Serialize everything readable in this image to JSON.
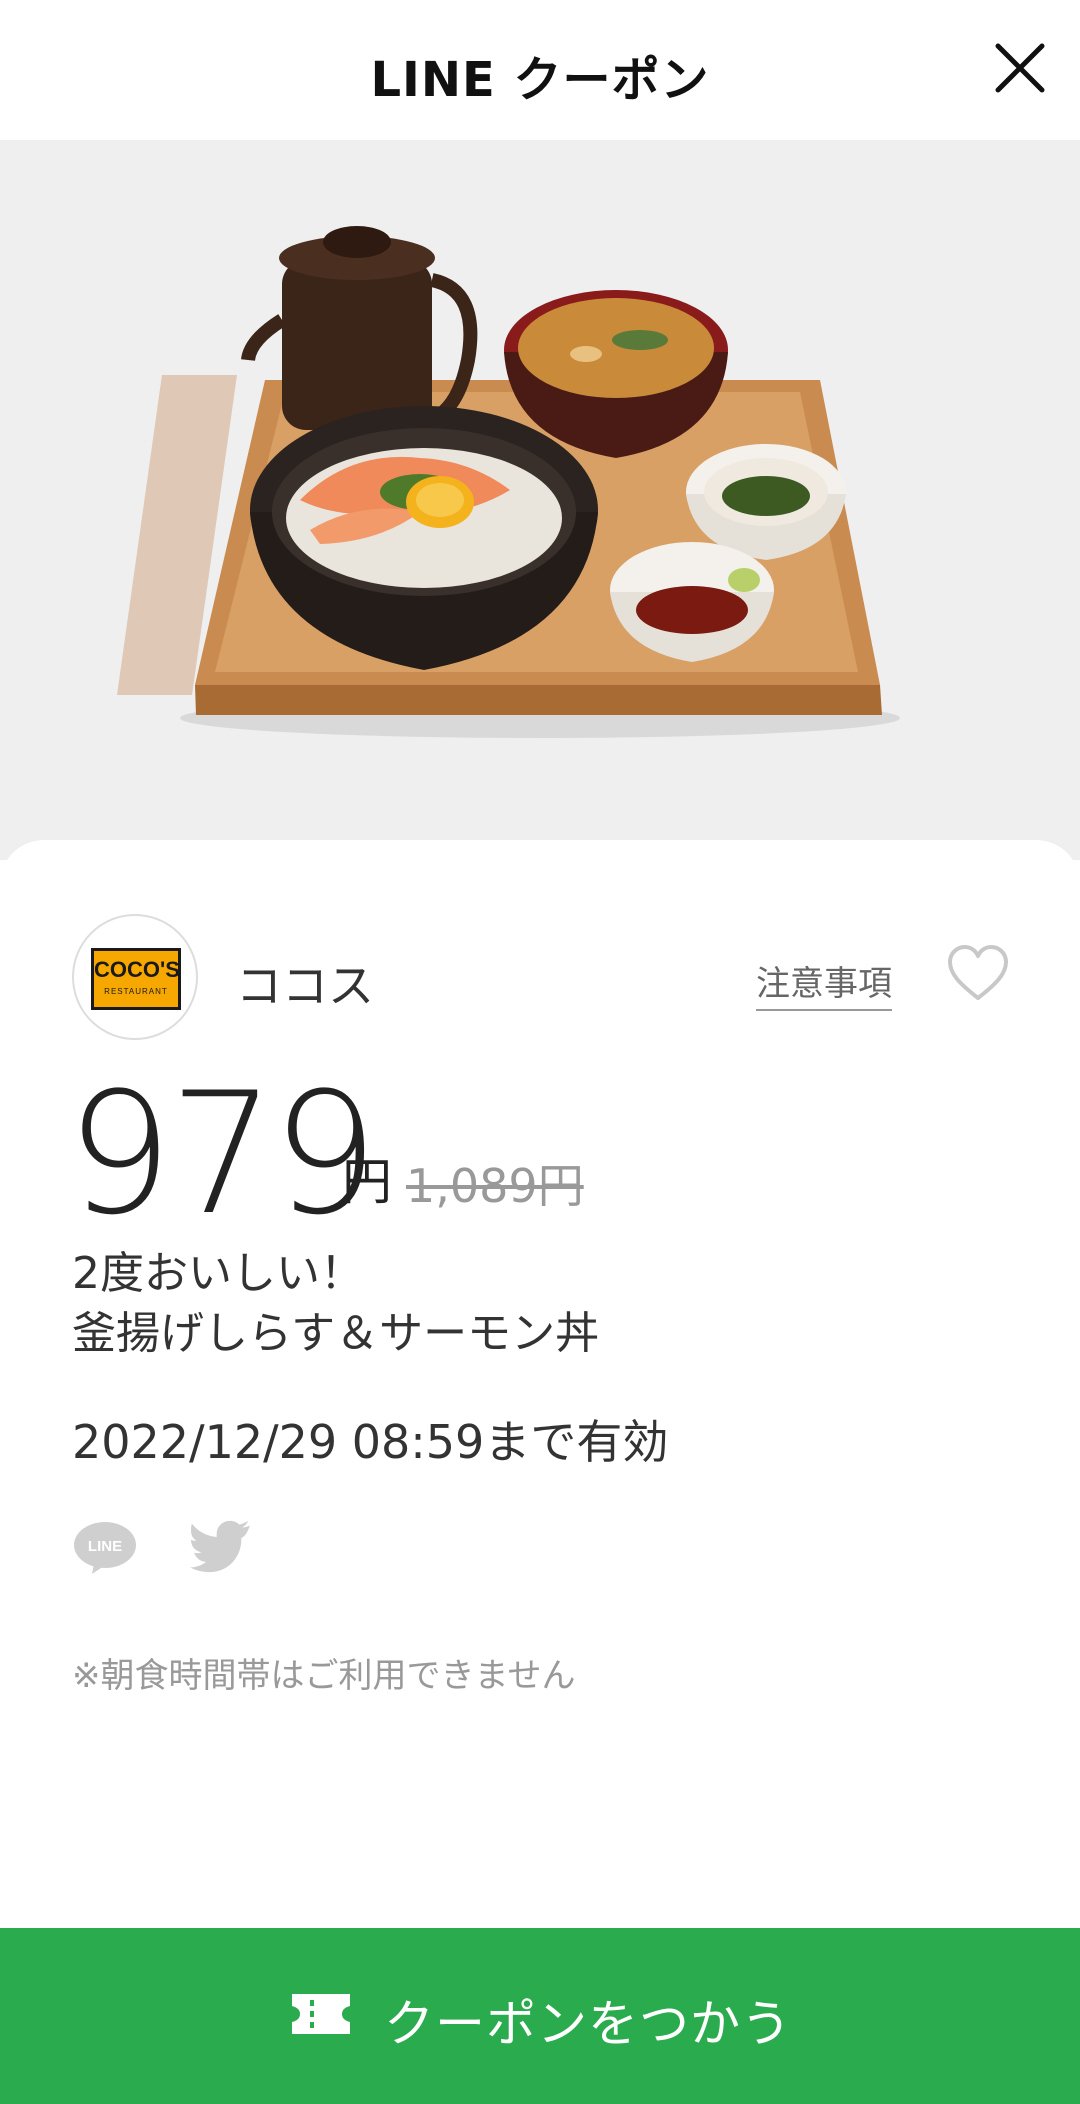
{
  "header": {
    "title": "LINE クーポン"
  },
  "hero": {
    "image_description": "food-photo"
  },
  "shop": {
    "name": "ココス",
    "logo_text": "COCO'S",
    "logo_sub": "RESTAURANT",
    "notes_label": "注意事項"
  },
  "offer": {
    "price": "979",
    "price_unit": "円",
    "original_price": "1,089円",
    "title_line1": "2度おいしい！",
    "title_line2": "釜揚げしらす＆サーモン丼",
    "validity": "2022/12/29  08:59まで有効",
    "notice": "※朝食時間帯はご利用できません"
  },
  "share": {
    "line_icon_text": "LINE"
  },
  "action": {
    "use_label": "クーポンをつかう"
  },
  "colors": {
    "accent_green": "#2aab4e",
    "logo_orange": "#f6a800",
    "hero_bg": "#efefef"
  }
}
